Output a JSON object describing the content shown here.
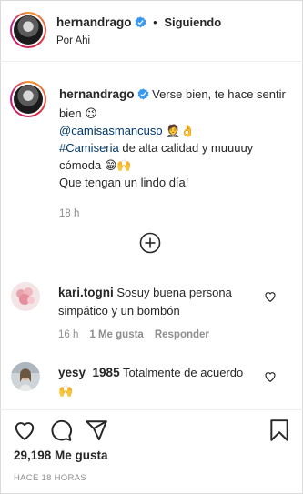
{
  "post": {
    "username": "hernandrago",
    "separator": "•",
    "follow_label": "Siguiendo",
    "location": "Por Ahi"
  },
  "caption": {
    "username": "hernandrago",
    "text_1": " Verse bien, te hace sentir bien 😉",
    "mention": "@camisasmancuso",
    "mention_emoji": " 🤵👌",
    "hashtag": "#Camiseria",
    "text_2": " de alta calidad y muuuuy cómoda 😁🙌",
    "text_3": "Que tengan un lindo día!",
    "age": "18 h"
  },
  "load_more_icon": "plus-circle-icon",
  "comments": [
    {
      "username": "kari.togni",
      "text": " Sosuy buena persona simpático y un bombón",
      "age": "16 h",
      "likes": "1 Me gusta",
      "reply": "Responder"
    },
    {
      "username": "yesy_1985",
      "text": " Totalmente de acuerdo 🙌"
    }
  ],
  "actions": {
    "icons": [
      "heart-icon",
      "comment-icon",
      "share-icon",
      "bookmark-icon"
    ],
    "likes_label": "29,198 Me gusta",
    "timestamp": "HACE 18 HORAS"
  },
  "colors": {
    "text": "#262626",
    "muted": "#8e8e8e",
    "link": "#00376b",
    "verified": "#3897f0",
    "border": "#dbdbdb"
  }
}
